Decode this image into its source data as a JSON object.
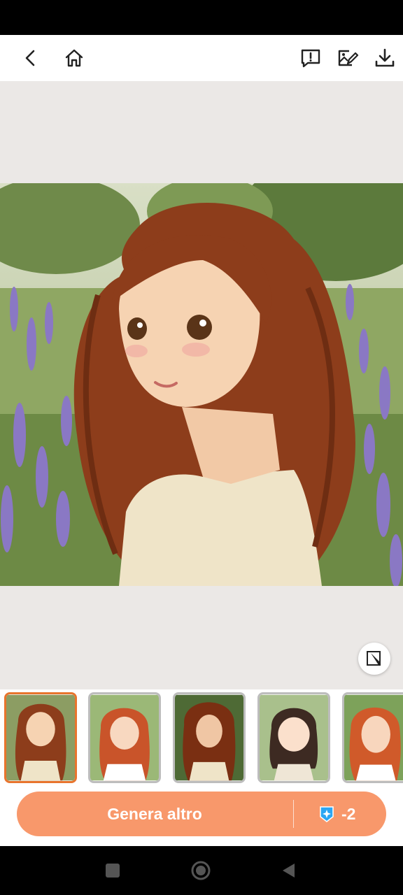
{
  "header": {
    "back_icon": "chevron-left-icon",
    "home_icon": "home-icon",
    "report_icon": "feedback-alert-icon",
    "edit_image_icon": "image-edit-icon",
    "download_icon": "download-icon"
  },
  "preview": {
    "edit_fab_icon": "edit-icon"
  },
  "thumbnails": [
    {
      "style": "auburn-ghibli",
      "selected": true
    },
    {
      "style": "red-hair-cartoon",
      "selected": false
    },
    {
      "style": "curly-comic",
      "selected": false
    },
    {
      "style": "chibi-brunette",
      "selected": false
    },
    {
      "style": "flat-cartoon",
      "selected": false
    }
  ],
  "footer": {
    "generate_label": "Genera altro",
    "credit_icon": "credit-gem-icon",
    "credit_cost": "-2"
  },
  "colors": {
    "accent": "#f8986b",
    "selected_border": "#e8742d",
    "canvas_bg": "#ebe8e6"
  },
  "system_nav": {
    "recents_icon": "square-icon",
    "home_icon": "circle-icon",
    "back_icon": "triangle-left-icon"
  }
}
